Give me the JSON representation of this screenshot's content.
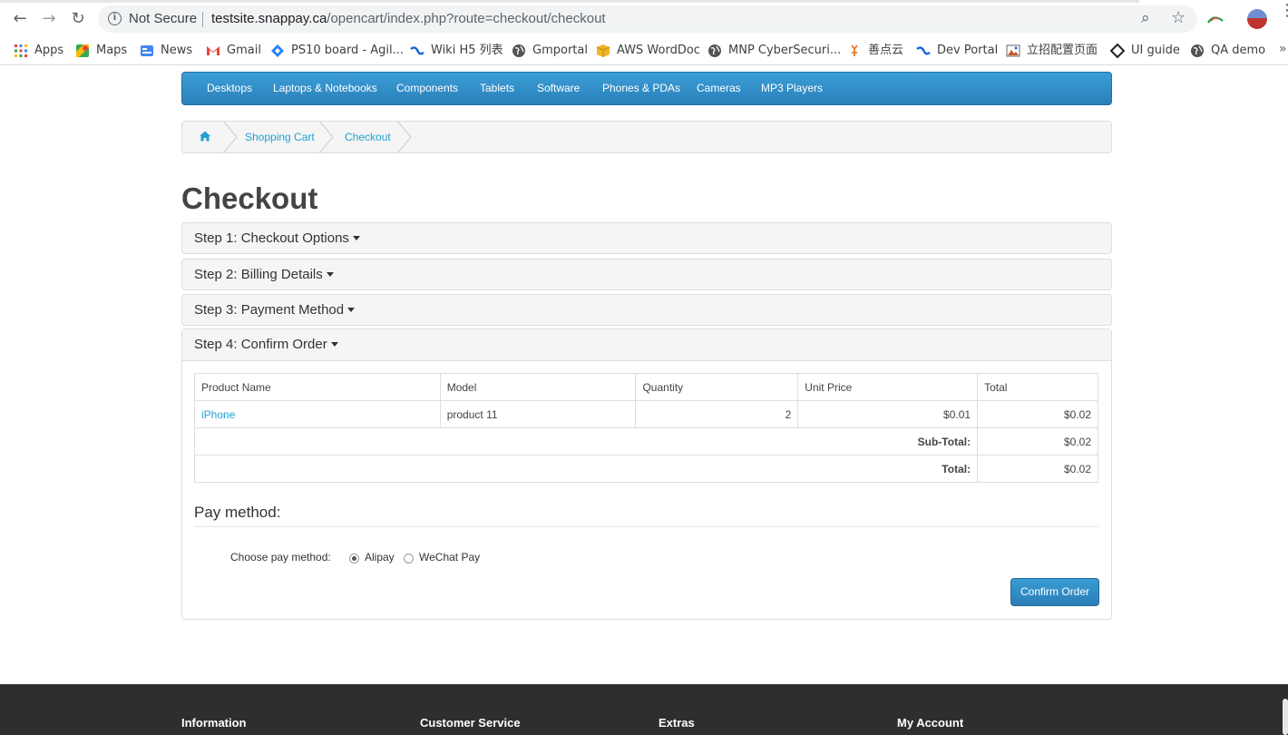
{
  "browser": {
    "security_label": "Not Secure",
    "url_host": "testsite.snappay.ca",
    "url_path": "/opencart/index.php?route=checkout/checkout"
  },
  "bookmarks": [
    {
      "label": "Apps",
      "icon": "apps-grid-icon"
    },
    {
      "label": "Maps",
      "icon": "maps-icon"
    },
    {
      "label": "News",
      "icon": "news-icon"
    },
    {
      "label": "Gmail",
      "icon": "gmail-icon"
    },
    {
      "label": "PS10 board - Agil...",
      "icon": "jira-icon"
    },
    {
      "label": "Wiki H5 列表",
      "icon": "confluence-icon"
    },
    {
      "label": "Gmportal",
      "icon": "globe-icon"
    },
    {
      "label": "AWS WordDoc",
      "icon": "box-icon"
    },
    {
      "label": "MNP CyberSecuri...",
      "icon": "globe-icon"
    },
    {
      "label": "善点云",
      "icon": "shandian-icon"
    },
    {
      "label": "Dev Portal",
      "icon": "confluence-icon"
    },
    {
      "label": "立招配置页面",
      "icon": "image-icon"
    },
    {
      "label": "UI guide",
      "icon": "diamond-icon"
    },
    {
      "label": "QA demo",
      "icon": "globe-icon"
    }
  ],
  "menu": [
    "Desktops",
    "Laptops & Notebooks",
    "Components",
    "Tablets",
    "Software",
    "Phones & PDAs",
    "Cameras",
    "MP3 Players"
  ],
  "breadcrumb": [
    "Shopping Cart",
    "Checkout"
  ],
  "page_title": "Checkout",
  "steps": [
    "Step 1: Checkout Options",
    "Step 2: Billing Details",
    "Step 3: Payment Method",
    "Step 4: Confirm Order"
  ],
  "order": {
    "headers": [
      "Product Name",
      "Model",
      "Quantity",
      "Unit Price",
      "Total"
    ],
    "rows": [
      {
        "name": "iPhone",
        "model": "product 11",
        "quantity": "2",
        "unit_price": "$0.01",
        "total": "$0.02"
      }
    ],
    "subtotal_label": "Sub-Total:",
    "subtotal_value": "$0.02",
    "total_label": "Total:",
    "total_value": "$0.02"
  },
  "pay": {
    "title": "Pay method:",
    "choose_label": "Choose pay method:",
    "options": [
      "Alipay",
      "WeChat Pay"
    ],
    "selected": "Alipay",
    "confirm_label": "Confirm Order"
  },
  "footer": [
    "Information",
    "Customer Service",
    "Extras",
    "My Account"
  ],
  "colors": {
    "menu_blue": "#2a80b9",
    "link_blue": "#23a1d1",
    "footer": "#2e2e2e"
  }
}
